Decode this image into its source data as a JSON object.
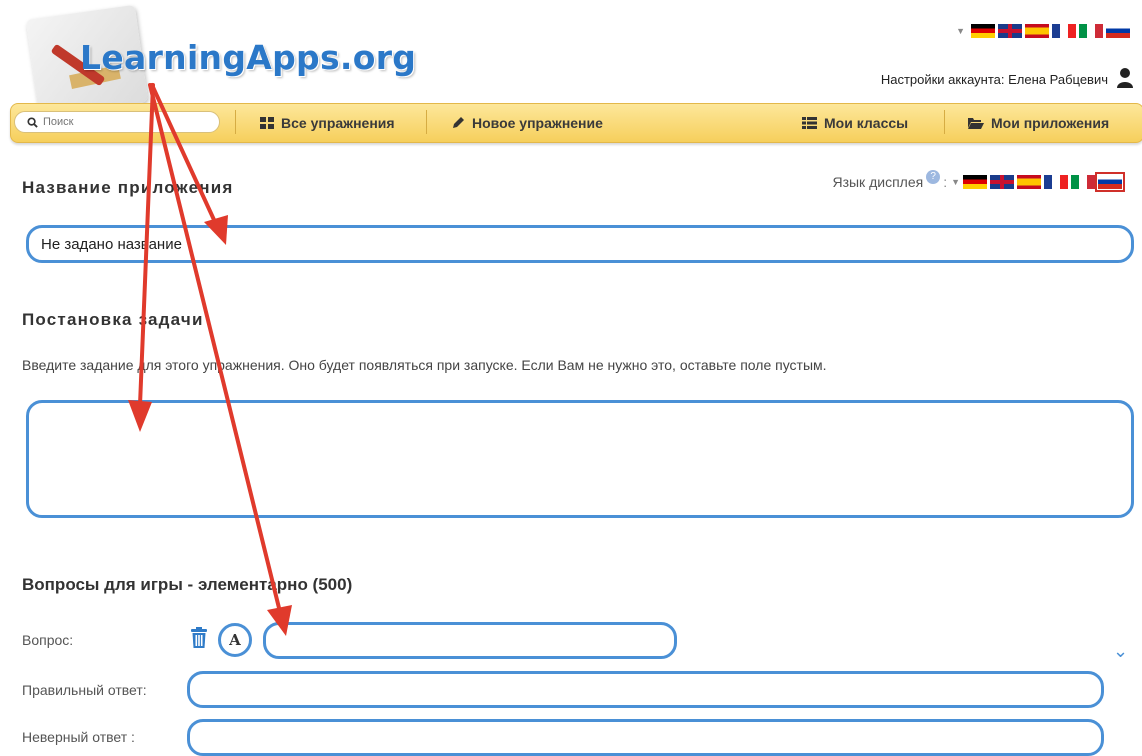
{
  "header": {
    "logo_text": "LearningApps.org",
    "account_label": "Настройки аккаунта: Елена Рабцевич",
    "flags": [
      "de",
      "gb",
      "es",
      "fr",
      "it",
      "ru"
    ]
  },
  "nav": {
    "search_placeholder": "Поиск",
    "all_exercises": "Все упражнения",
    "new_exercise": "Новое упражнение",
    "my_classes": "Мои классы",
    "my_apps": "Мои приложения"
  },
  "app_name": {
    "heading": "Название приложения",
    "display_language_label": "Язык дисплея",
    "value": "Не задано название"
  },
  "task": {
    "heading": "Постановка задачи",
    "description": "Введите задание для этого упражнения. Оно будет появляться при запуске. Если Вам не нужно это, оставьте поле пустым.",
    "value": ""
  },
  "questions": {
    "heading": "Вопросы для игры - элементарно (500)",
    "question_label": "Вопрос:",
    "correct_label": "Правильный ответ:",
    "wrong_label": "Неверный ответ :",
    "a_button": "A"
  },
  "colors": {
    "accent": "#4a90d6",
    "navbar": "#f6cf5c",
    "arrow": "#e03a2c"
  }
}
